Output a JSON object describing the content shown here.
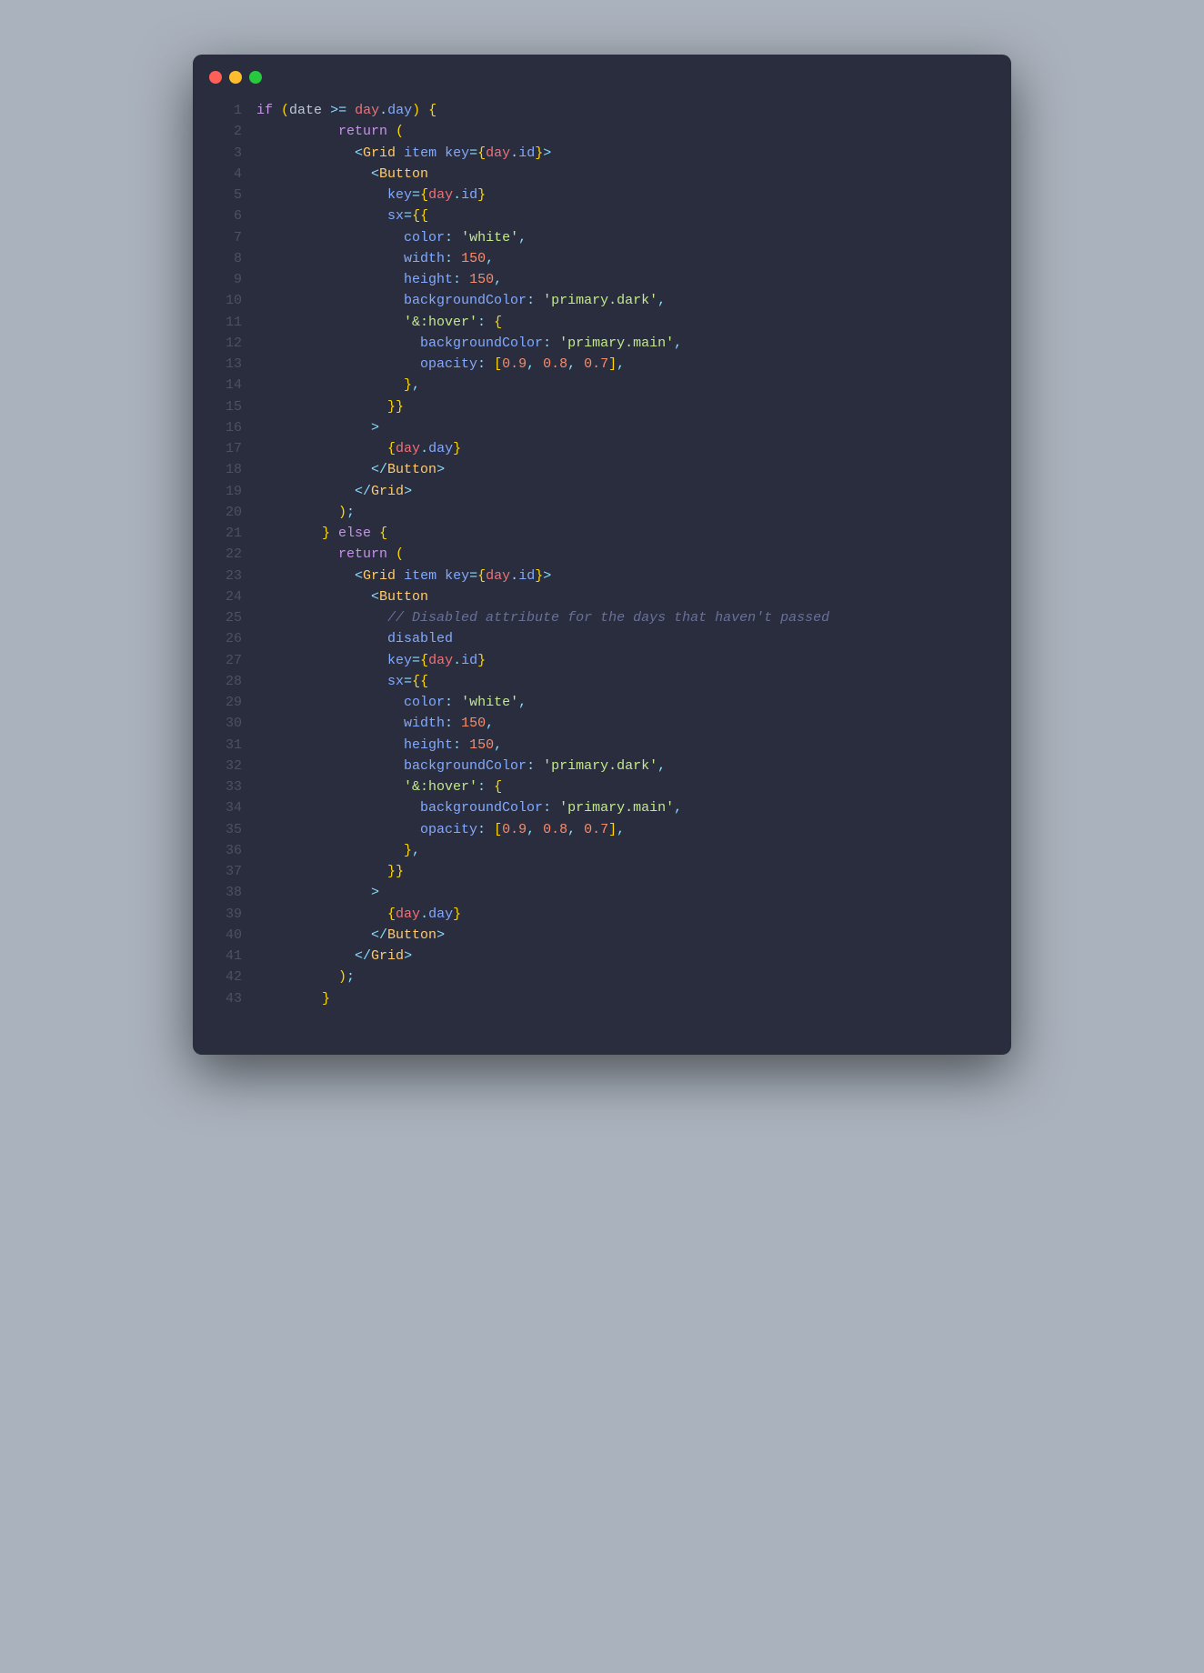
{
  "window": {
    "theme": "material-palenight"
  },
  "code": {
    "lines": [
      [
        [
          "kw",
          "if"
        ],
        [
          "op",
          " "
        ],
        [
          "br",
          "("
        ],
        [
          "var",
          "date "
        ],
        [
          "op",
          ">="
        ],
        [
          "var",
          " "
        ],
        [
          "tag",
          "day"
        ],
        [
          "p",
          "."
        ],
        [
          "prop",
          "day"
        ],
        [
          "br",
          ")"
        ],
        [
          "var",
          " "
        ],
        [
          "br",
          "{"
        ]
      ],
      [
        [
          "var",
          "          "
        ],
        [
          "kw",
          "return"
        ],
        [
          "var",
          " "
        ],
        [
          "br",
          "("
        ]
      ],
      [
        [
          "var",
          "            "
        ],
        [
          "p",
          "<"
        ],
        [
          "cmp",
          "Grid"
        ],
        [
          "var",
          " "
        ],
        [
          "prop",
          "item"
        ],
        [
          "var",
          " "
        ],
        [
          "prop",
          "key"
        ],
        [
          "op",
          "="
        ],
        [
          "br",
          "{"
        ],
        [
          "tag",
          "day"
        ],
        [
          "p",
          "."
        ],
        [
          "prop",
          "id"
        ],
        [
          "br",
          "}"
        ],
        [
          "p",
          ">"
        ]
      ],
      [
        [
          "var",
          "              "
        ],
        [
          "p",
          "<"
        ],
        [
          "cmp",
          "Button"
        ]
      ],
      [
        [
          "var",
          "                "
        ],
        [
          "prop",
          "key"
        ],
        [
          "op",
          "="
        ],
        [
          "br",
          "{"
        ],
        [
          "tag",
          "day"
        ],
        [
          "p",
          "."
        ],
        [
          "prop",
          "id"
        ],
        [
          "br",
          "}"
        ]
      ],
      [
        [
          "var",
          "                "
        ],
        [
          "prop",
          "sx"
        ],
        [
          "op",
          "="
        ],
        [
          "br",
          "{{"
        ]
      ],
      [
        [
          "var",
          "                  "
        ],
        [
          "prop",
          "color"
        ],
        [
          "p",
          ": "
        ],
        [
          "str",
          "'white'"
        ],
        [
          "p",
          ","
        ]
      ],
      [
        [
          "var",
          "                  "
        ],
        [
          "prop",
          "width"
        ],
        [
          "p",
          ": "
        ],
        [
          "num",
          "150"
        ],
        [
          "p",
          ","
        ]
      ],
      [
        [
          "var",
          "                  "
        ],
        [
          "prop",
          "height"
        ],
        [
          "p",
          ": "
        ],
        [
          "num",
          "150"
        ],
        [
          "p",
          ","
        ]
      ],
      [
        [
          "var",
          "                  "
        ],
        [
          "prop",
          "backgroundColor"
        ],
        [
          "p",
          ": "
        ],
        [
          "str",
          "'primary.dark'"
        ],
        [
          "p",
          ","
        ]
      ],
      [
        [
          "var",
          "                  "
        ],
        [
          "str",
          "'&:hover'"
        ],
        [
          "p",
          ": "
        ],
        [
          "br",
          "{"
        ]
      ],
      [
        [
          "var",
          "                    "
        ],
        [
          "prop",
          "backgroundColor"
        ],
        [
          "p",
          ": "
        ],
        [
          "str",
          "'primary.main'"
        ],
        [
          "p",
          ","
        ]
      ],
      [
        [
          "var",
          "                    "
        ],
        [
          "prop",
          "opacity"
        ],
        [
          "p",
          ": "
        ],
        [
          "br",
          "["
        ],
        [
          "num",
          "0.9"
        ],
        [
          "p",
          ", "
        ],
        [
          "num",
          "0.8"
        ],
        [
          "p",
          ", "
        ],
        [
          "num",
          "0.7"
        ],
        [
          "br",
          "]"
        ],
        [
          "p",
          ","
        ]
      ],
      [
        [
          "var",
          "                  "
        ],
        [
          "br",
          "}"
        ],
        [
          "p",
          ","
        ]
      ],
      [
        [
          "var",
          "                "
        ],
        [
          "br",
          "}}"
        ]
      ],
      [
        [
          "var",
          "              "
        ],
        [
          "p",
          ">"
        ]
      ],
      [
        [
          "var",
          "                "
        ],
        [
          "br",
          "{"
        ],
        [
          "tag",
          "day"
        ],
        [
          "p",
          "."
        ],
        [
          "prop",
          "day"
        ],
        [
          "br",
          "}"
        ]
      ],
      [
        [
          "var",
          "              "
        ],
        [
          "p",
          "</"
        ],
        [
          "cmp",
          "Button"
        ],
        [
          "p",
          ">"
        ]
      ],
      [
        [
          "var",
          "            "
        ],
        [
          "p",
          "</"
        ],
        [
          "cmp",
          "Grid"
        ],
        [
          "p",
          ">"
        ]
      ],
      [
        [
          "var",
          "          "
        ],
        [
          "br",
          ")"
        ],
        [
          "p",
          ";"
        ]
      ],
      [
        [
          "var",
          "        "
        ],
        [
          "br",
          "}"
        ],
        [
          "var",
          " "
        ],
        [
          "kw",
          "else"
        ],
        [
          "var",
          " "
        ],
        [
          "br",
          "{"
        ]
      ],
      [
        [
          "var",
          "          "
        ],
        [
          "kw",
          "return"
        ],
        [
          "var",
          " "
        ],
        [
          "br",
          "("
        ]
      ],
      [
        [
          "var",
          "            "
        ],
        [
          "p",
          "<"
        ],
        [
          "cmp",
          "Grid"
        ],
        [
          "var",
          " "
        ],
        [
          "prop",
          "item"
        ],
        [
          "var",
          " "
        ],
        [
          "prop",
          "key"
        ],
        [
          "op",
          "="
        ],
        [
          "br",
          "{"
        ],
        [
          "tag",
          "day"
        ],
        [
          "p",
          "."
        ],
        [
          "prop",
          "id"
        ],
        [
          "br",
          "}"
        ],
        [
          "p",
          ">"
        ]
      ],
      [
        [
          "var",
          "              "
        ],
        [
          "p",
          "<"
        ],
        [
          "cmp",
          "Button"
        ]
      ],
      [
        [
          "var",
          "                "
        ],
        [
          "com",
          "// Disabled attribute for the days that haven't passed"
        ]
      ],
      [
        [
          "var",
          "                "
        ],
        [
          "prop",
          "disabled"
        ]
      ],
      [
        [
          "var",
          "                "
        ],
        [
          "prop",
          "key"
        ],
        [
          "op",
          "="
        ],
        [
          "br",
          "{"
        ],
        [
          "tag",
          "day"
        ],
        [
          "p",
          "."
        ],
        [
          "prop",
          "id"
        ],
        [
          "br",
          "}"
        ]
      ],
      [
        [
          "var",
          "                "
        ],
        [
          "prop",
          "sx"
        ],
        [
          "op",
          "="
        ],
        [
          "br",
          "{{"
        ]
      ],
      [
        [
          "var",
          "                  "
        ],
        [
          "prop",
          "color"
        ],
        [
          "p",
          ": "
        ],
        [
          "str",
          "'white'"
        ],
        [
          "p",
          ","
        ]
      ],
      [
        [
          "var",
          "                  "
        ],
        [
          "prop",
          "width"
        ],
        [
          "p",
          ": "
        ],
        [
          "num",
          "150"
        ],
        [
          "p",
          ","
        ]
      ],
      [
        [
          "var",
          "                  "
        ],
        [
          "prop",
          "height"
        ],
        [
          "p",
          ": "
        ],
        [
          "num",
          "150"
        ],
        [
          "p",
          ","
        ]
      ],
      [
        [
          "var",
          "                  "
        ],
        [
          "prop",
          "backgroundColor"
        ],
        [
          "p",
          ": "
        ],
        [
          "str",
          "'primary.dark'"
        ],
        [
          "p",
          ","
        ]
      ],
      [
        [
          "var",
          "                  "
        ],
        [
          "str",
          "'&:hover'"
        ],
        [
          "p",
          ": "
        ],
        [
          "br",
          "{"
        ]
      ],
      [
        [
          "var",
          "                    "
        ],
        [
          "prop",
          "backgroundColor"
        ],
        [
          "p",
          ": "
        ],
        [
          "str",
          "'primary.main'"
        ],
        [
          "p",
          ","
        ]
      ],
      [
        [
          "var",
          "                    "
        ],
        [
          "prop",
          "opacity"
        ],
        [
          "p",
          ": "
        ],
        [
          "br",
          "["
        ],
        [
          "num",
          "0.9"
        ],
        [
          "p",
          ", "
        ],
        [
          "num",
          "0.8"
        ],
        [
          "p",
          ", "
        ],
        [
          "num",
          "0.7"
        ],
        [
          "br",
          "]"
        ],
        [
          "p",
          ","
        ]
      ],
      [
        [
          "var",
          "                  "
        ],
        [
          "br",
          "}"
        ],
        [
          "p",
          ","
        ]
      ],
      [
        [
          "var",
          "                "
        ],
        [
          "br",
          "}}"
        ]
      ],
      [
        [
          "var",
          "              "
        ],
        [
          "p",
          ">"
        ]
      ],
      [
        [
          "var",
          "                "
        ],
        [
          "br",
          "{"
        ],
        [
          "tag",
          "day"
        ],
        [
          "p",
          "."
        ],
        [
          "prop",
          "day"
        ],
        [
          "br",
          "}"
        ]
      ],
      [
        [
          "var",
          "              "
        ],
        [
          "p",
          "</"
        ],
        [
          "cmp",
          "Button"
        ],
        [
          "p",
          ">"
        ]
      ],
      [
        [
          "var",
          "            "
        ],
        [
          "p",
          "</"
        ],
        [
          "cmp",
          "Grid"
        ],
        [
          "p",
          ">"
        ]
      ],
      [
        [
          "var",
          "          "
        ],
        [
          "br",
          ")"
        ],
        [
          "p",
          ";"
        ]
      ],
      [
        [
          "var",
          "        "
        ],
        [
          "br",
          "}"
        ]
      ]
    ]
  }
}
